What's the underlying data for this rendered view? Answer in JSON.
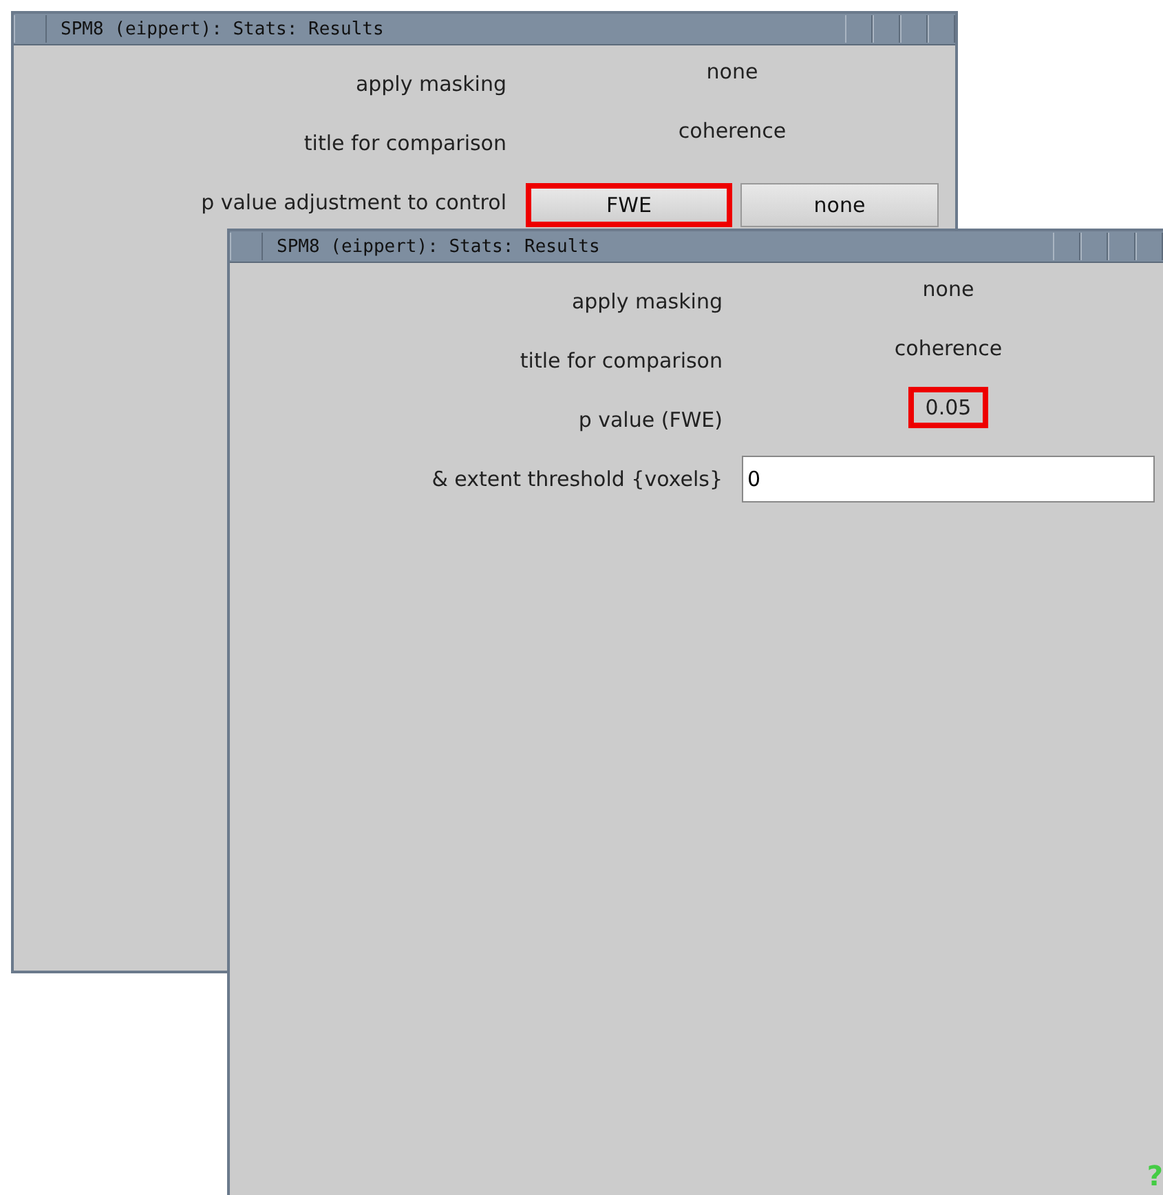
{
  "windows": [
    {
      "title": "SPM8 (eippert): Stats: Results",
      "rows": [
        {
          "kind": "text",
          "label": "apply masking",
          "value": "none",
          "highlighted": false
        },
        {
          "kind": "text",
          "label": "title for comparison",
          "value": "coherence",
          "highlighted": false
        },
        {
          "kind": "buttons",
          "label": "p value adjustment to control",
          "buttons": [
            {
              "label": "FWE",
              "highlighted": true
            },
            {
              "label": "none",
              "highlighted": false
            }
          ]
        }
      ]
    },
    {
      "title": "SPM8 (eippert): Stats: Results",
      "rows": [
        {
          "kind": "text",
          "label": "apply masking",
          "value": "none",
          "highlighted": false
        },
        {
          "kind": "text",
          "label": "title for comparison",
          "value": "coherence",
          "highlighted": false
        },
        {
          "kind": "text",
          "label": "p value (FWE)",
          "value": "0.05",
          "highlighted": true
        },
        {
          "kind": "input",
          "label": "& extent threshold {voxels}",
          "value": "0"
        }
      ],
      "help": "?"
    }
  ]
}
